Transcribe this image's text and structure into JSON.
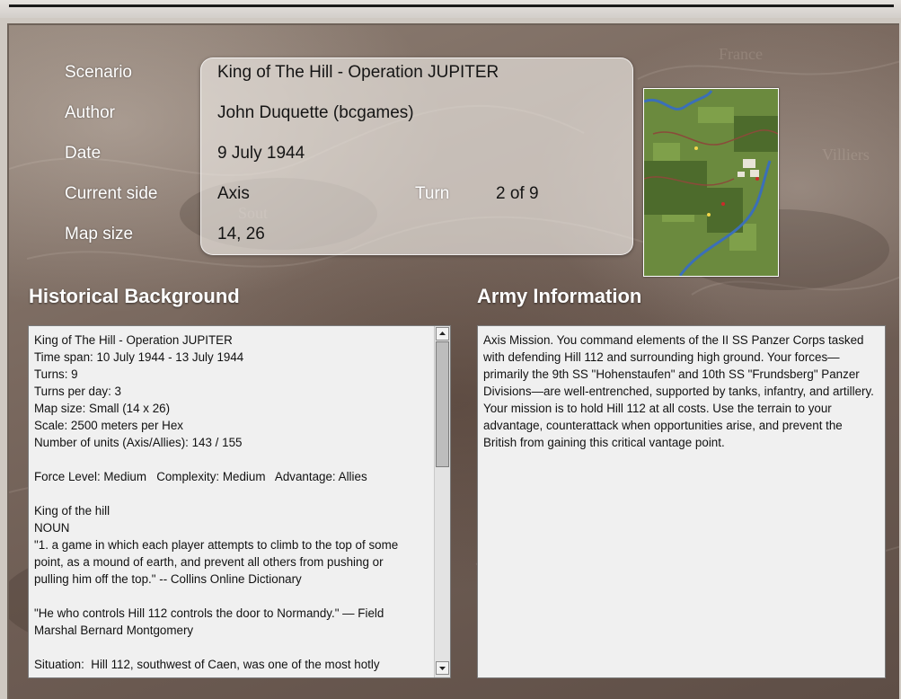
{
  "scenario_info": {
    "scenario_label": "Scenario",
    "scenario_value": "King of The Hill - Operation JUPITER",
    "author_label": "Author",
    "author_value": "John Duquette (bcgames)",
    "date_label": "Date",
    "date_value": "9 July 1944",
    "side_label": "Current side",
    "side_value": "Axis",
    "turn_label": "Turn",
    "turn_value": "2 of 9",
    "mapsize_label": "Map size",
    "mapsize_value": "14, 26"
  },
  "historical": {
    "title": "Historical Background",
    "lines": [
      "King of The Hill - Operation JUPITER",
      "Time span: 10 July 1944 - 13 July 1944",
      "Turns: 9",
      "Turns per day: 3",
      "Map size: Small (14 x 26)",
      "Scale: 2500 meters per Hex",
      "Number of units (Axis/Allies): 143 / 155",
      "",
      "Force Level: Medium   Complexity: Medium   Advantage: Allies",
      "",
      "King of the hill",
      "NOUN",
      "\"1. a game in which each player attempts to climb to the top of some",
      "point, as a mound of earth, and prevent all others from pushing or",
      "pulling him off the top.\" -- Collins Online Dictionary",
      "",
      "\"He who controls Hill 112 controls the door to Normandy.\" — Field",
      "Marshal Bernard Montgomery",
      "",
      "Situation:  Hill 112, southwest of Caen, was one of the most hotly"
    ]
  },
  "army": {
    "title": "Army Information",
    "text": "Axis Mission. You command elements of the II SS Panzer Corps tasked with defending Hill 112 and surrounding high ground. Your forces—primarily the 9th SS \"Hohenstaufen\" and 10th SS \"Frundsberg\" Panzer Divisions—are well-entrenched, supported by tanks, infantry, and artillery. Your mission is to hold Hill 112 at all costs. Use the terrain to your advantage, counterattack when opportunities arise, and prevent the British from gaining this critical vantage point."
  },
  "icons": {
    "scroll_up": "arrow-up-icon",
    "scroll_down": "arrow-down-icon"
  }
}
